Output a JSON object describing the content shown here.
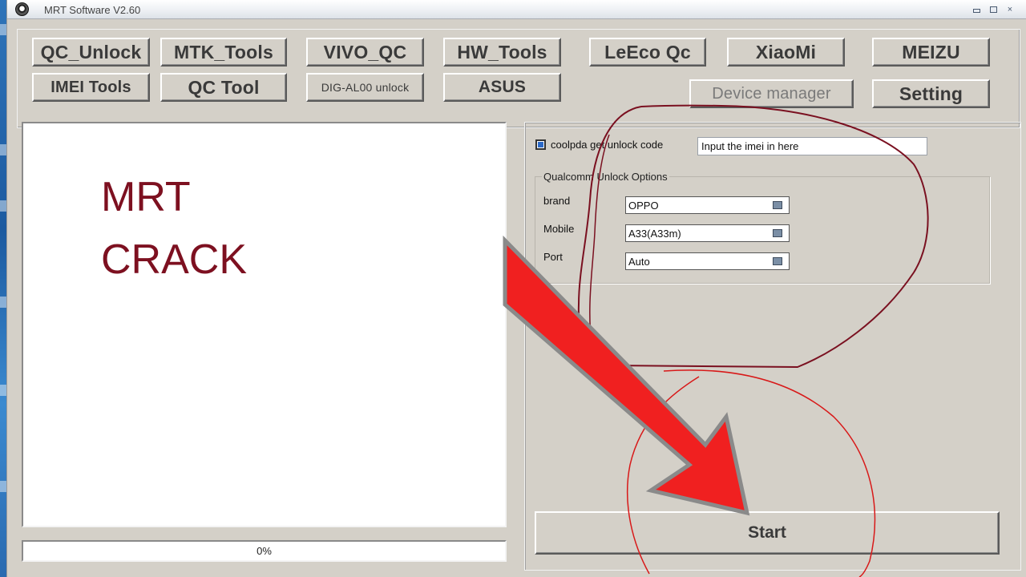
{
  "window": {
    "title": "MRT Software V2.60",
    "icon": "app-logo-icon",
    "controls": [
      "minimize-icon",
      "maximize-icon",
      "close-icon"
    ]
  },
  "toolbar": {
    "buttons": {
      "qc_unlock": "QC_Unlock",
      "mtk_tools": "MTK_Tools",
      "vivo_qc": "VIVO_QC",
      "hw_tools": "HW_Tools",
      "leeco_qc": "LeEco Qc",
      "xiaomi": "XiaoMi",
      "meizu": "MEIZU",
      "imei_tools": "IMEI Tools",
      "qc_tool": "QC Tool",
      "dig_al00": "DIG-AL00 unlock",
      "asus": "ASUS",
      "device_manager": "Device manager",
      "setting": "Setting"
    }
  },
  "log": {
    "line1": "MRT",
    "line2": "CRACK"
  },
  "progress": {
    "label": "0%",
    "value": 0
  },
  "options": {
    "coolpda_label": "coolpda get unlock code",
    "coolpda_checked": true,
    "imei_value": "Input the imei in here",
    "group_title": "Qualcomm Unlock Options",
    "brand_label": "brand",
    "brand_value": "OPPO",
    "mobile_label": "Mobile",
    "mobile_value": "A33(A33m)",
    "port_label": "Port",
    "port_value": "Auto",
    "start_label": "Start"
  },
  "colors": {
    "window_bg": "#d4d0c8",
    "crack_text": "#7d1020",
    "arrow_fill": "#f02020",
    "annotation_maroon": "#7a1020",
    "annotation_red": "#d81818"
  }
}
